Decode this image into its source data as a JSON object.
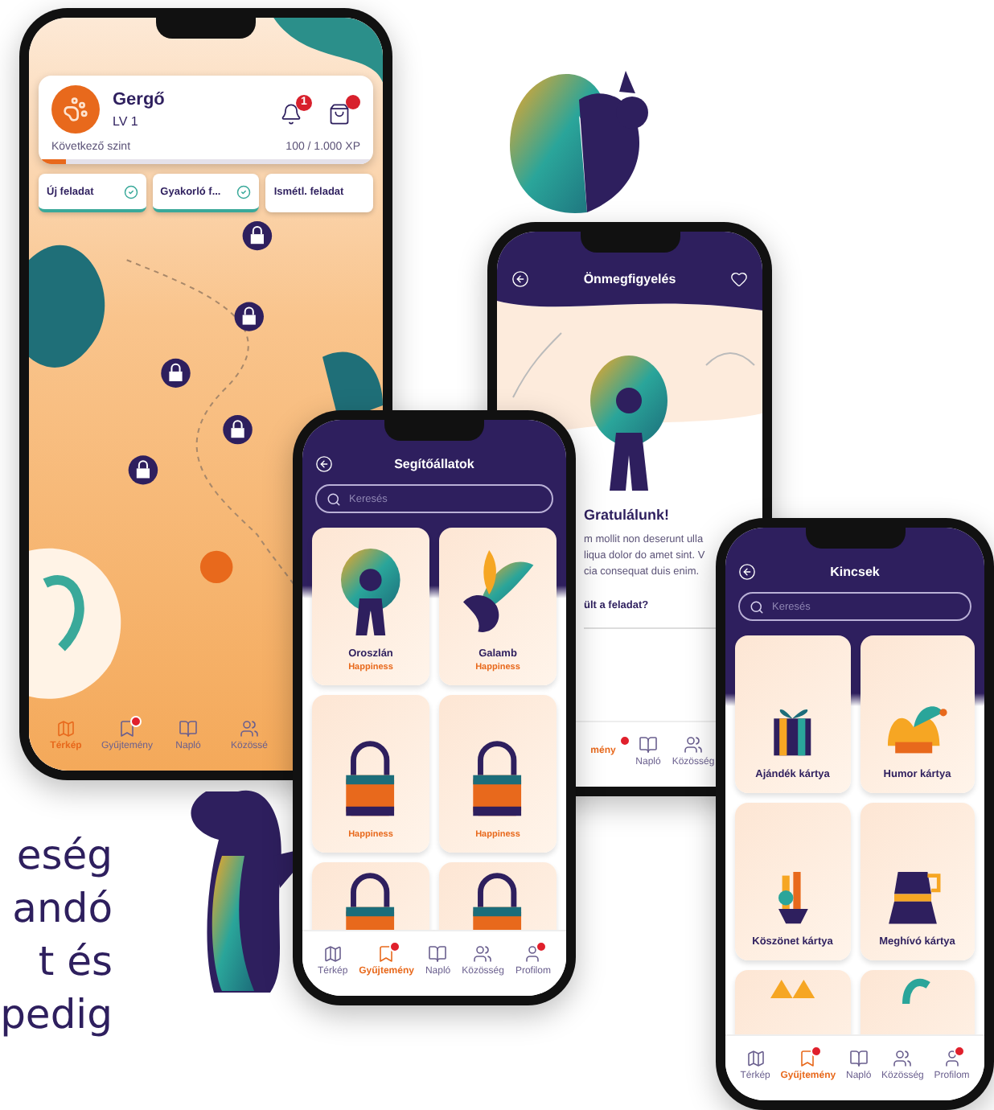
{
  "intro_text": "eség\nandó\nt és\npedig",
  "map_phone": {
    "profile": {
      "name": "Gergő",
      "rank": "LV 1",
      "notifications": "1",
      "cart_badge": true,
      "next_label": "Következő szint",
      "xp": "100 / 1.000 XP",
      "progress": {
        "level": 0.08
      }
    },
    "tasks": [
      {
        "label": "Új feladat",
        "checked": true
      },
      {
        "label": "Gyakorló f...",
        "checked": true
      },
      {
        "label": "Ismétl. feladat",
        "checked": false
      }
    ],
    "nav": [
      {
        "kind": "map",
        "label": "Térkép",
        "selected": true,
        "badge": false
      },
      {
        "kind": "collection",
        "label": "Gyűjtemény",
        "selected": false,
        "badge": true
      },
      {
        "kind": "journal",
        "label": "Napló",
        "selected": false,
        "badge": false
      },
      {
        "kind": "community",
        "label": "Közössé",
        "selected": false,
        "badge": false
      }
    ]
  },
  "reflection_phone": {
    "title": "Önmegfigyelés",
    "heading": "Gratulálunk!",
    "body": "m mollit non deserunt ulla\nliqua dolor do amet sint. V\ncia consequat duis enim.",
    "question": "ült a feladat?",
    "nav": [
      {
        "kind": "text",
        "label": "mény",
        "selected": true,
        "badge": true
      },
      {
        "kind": "journal",
        "label": "Napló",
        "selected": false,
        "badge": false
      },
      {
        "kind": "community",
        "label": "Közösség",
        "selected": false,
        "badge": false
      }
    ]
  },
  "helpers_phone": {
    "title": "Segítőállatok",
    "search": {
      "placeholder": "Keresés"
    },
    "cards": [
      {
        "kind": "animal",
        "title": "Oroszlán",
        "subtitle": "Happiness"
      },
      {
        "kind": "animal",
        "title": "Galamb",
        "subtitle": "Happiness"
      },
      {
        "kind": "locked",
        "subtitle": "Happiness"
      },
      {
        "kind": "locked",
        "subtitle": "Happiness"
      },
      {
        "kind": "locked"
      },
      {
        "kind": "locked"
      }
    ],
    "nav": [
      {
        "kind": "map",
        "label": "Térkép",
        "selected": false,
        "badge": false
      },
      {
        "kind": "collection",
        "label": "Gyűjtemény",
        "selected": true,
        "badge": true
      },
      {
        "kind": "journal",
        "label": "Napló",
        "selected": false,
        "badge": false
      },
      {
        "kind": "community",
        "label": "Közösség",
        "selected": false,
        "badge": false
      },
      {
        "kind": "profile",
        "label": "Profilom",
        "selected": false,
        "badge": true
      }
    ]
  },
  "treasures_phone": {
    "title": "Kincsek",
    "search": {
      "placeholder": "Keresés"
    },
    "cards": [
      {
        "kind": "treasure",
        "title": "Ajándék kártya"
      },
      {
        "kind": "treasure",
        "title": "Humor kártya"
      },
      {
        "kind": "treasure",
        "title": "Köszönet kártya"
      },
      {
        "kind": "treasure",
        "title": "Meghívó kártya"
      },
      {
        "kind": "treasure"
      },
      {
        "kind": "treasure"
      }
    ],
    "nav": [
      {
        "kind": "map",
        "label": "Térkép",
        "selected": false,
        "badge": false
      },
      {
        "kind": "collection",
        "label": "Gyűjtemény",
        "selected": true,
        "badge": true
      },
      {
        "kind": "journal",
        "label": "Napló",
        "selected": false,
        "badge": false
      },
      {
        "kind": "community",
        "label": "Közösség",
        "selected": false,
        "badge": false
      },
      {
        "kind": "profile",
        "label": "Profilom",
        "selected": false,
        "badge": true
      }
    ]
  }
}
